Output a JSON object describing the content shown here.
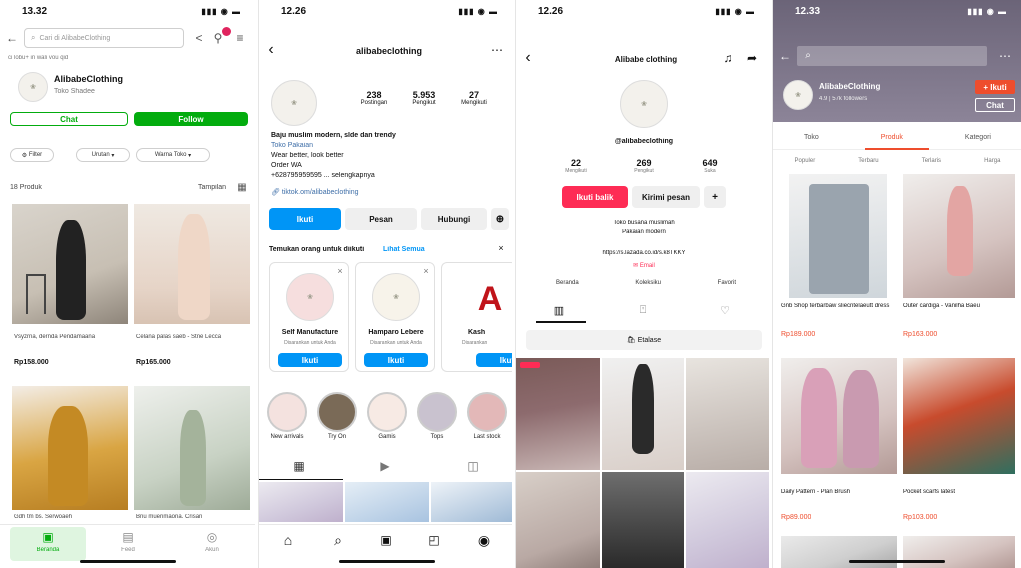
{
  "phone1": {
    "time": "13.32",
    "search_placeholder": "Cari di AlibabeClothing",
    "breadcrumb": "ci lobu+ in wali vou qid",
    "shop_name": "AlibabeClothing",
    "shop_sub": "Toko Shadee",
    "btn_chat": "Chat",
    "btn_follow": "Follow",
    "filter_label": "Filter",
    "filter_2": "Urutan",
    "filter_3": "Warna Toko",
    "product_count": "18 Produk",
    "view_label": "Tampilan",
    "products": [
      {
        "name": "Vsyzrna, dernda Pendamaana",
        "price": "Rp158.000"
      },
      {
        "name": "Celana palas saeb - Stne Lecca",
        "price": "Rp165.000"
      },
      {
        "name": "Gdh tm bs. Serwoaeh",
        "price": ""
      },
      {
        "name": "Bnu muerimaona. Crisan",
        "price": ""
      }
    ],
    "nav": [
      "Beranda",
      "Feed",
      "Akun"
    ]
  },
  "phone2": {
    "time": "12.26",
    "username": "alibabeclothing",
    "stats": [
      {
        "num": "238",
        "label": "Postingan"
      },
      {
        "num": "5.953",
        "label": "Pengikut"
      },
      {
        "num": "27",
        "label": "Mengikuti"
      }
    ],
    "bio_lines": [
      "Baju muslim modern, slde dan trendy",
      "Toko Pakaian",
      "Wear better, look better",
      "Order WA",
      "+628795959595 ... selengkapnya"
    ],
    "link": "tiktok.om/alibabeclothing",
    "btn_follow": "Ikuti",
    "btn_message": "Pesan",
    "btn_contact": "Hubungi",
    "suggest_title": "Temukan orang untuk diikuti",
    "suggest_link": "Lihat Semua",
    "suggestions": [
      {
        "name": "Self Manufacture",
        "sub": "Disarankan untuk Anda",
        "btn": "Ikuti"
      },
      {
        "name": "Hamparo Lebere",
        "sub": "Disarankan untuk Anda",
        "btn": "Ikuti"
      },
      {
        "name": "Kash",
        "sub": "Disarankan",
        "btn": "Ikuti"
      }
    ],
    "stories": [
      "New arrivals",
      "Try On",
      "Gamis",
      "Tops",
      "Last stock"
    ]
  },
  "phone3": {
    "time": "12.26",
    "title": "Alibabe clothing",
    "handle": "@alibabeclothing",
    "stats": [
      {
        "num": "22",
        "label": "Mengikuti"
      },
      {
        "num": "269",
        "label": "Pengikut"
      },
      {
        "num": "649",
        "label": "Suka"
      }
    ],
    "btn_follow": "Ikuti balik",
    "btn_message": "Kirimi pesan",
    "bio_1": "Toko busana muslimah",
    "bio_2": "Pakaian modern",
    "link": "https://s.lazada.co.id/s.k8TKKY",
    "email": "Email",
    "tabs_row": [
      "Beranda",
      "Koleksiku",
      "Favorit",
      "Karya"
    ],
    "showcase": "Etalase"
  },
  "phone4": {
    "time": "12.33",
    "shop_name": "AlibabeClothing",
    "shop_meta": "4.9 | 57k followers",
    "btn_follow": "+ Ikuti",
    "btn_chat": "Chat",
    "tabs": [
      "Toko",
      "Produk",
      "Kategori"
    ],
    "subtabs": [
      "Populer",
      "Terbaru",
      "Terlaris",
      "Harga"
    ],
    "products": [
      {
        "name": "Gnb Shop terbarbaw sliecntelaeutt dress",
        "price": "Rp189.000"
      },
      {
        "name": "Outer cardiga - Vanilha Baeu",
        "price": "Rp163.000"
      },
      {
        "name": "Daily Pattern - Plan Brush",
        "price": "Rp89.000"
      },
      {
        "name": "Pocket scarfs latest",
        "price": "Rp103.000"
      }
    ]
  }
}
